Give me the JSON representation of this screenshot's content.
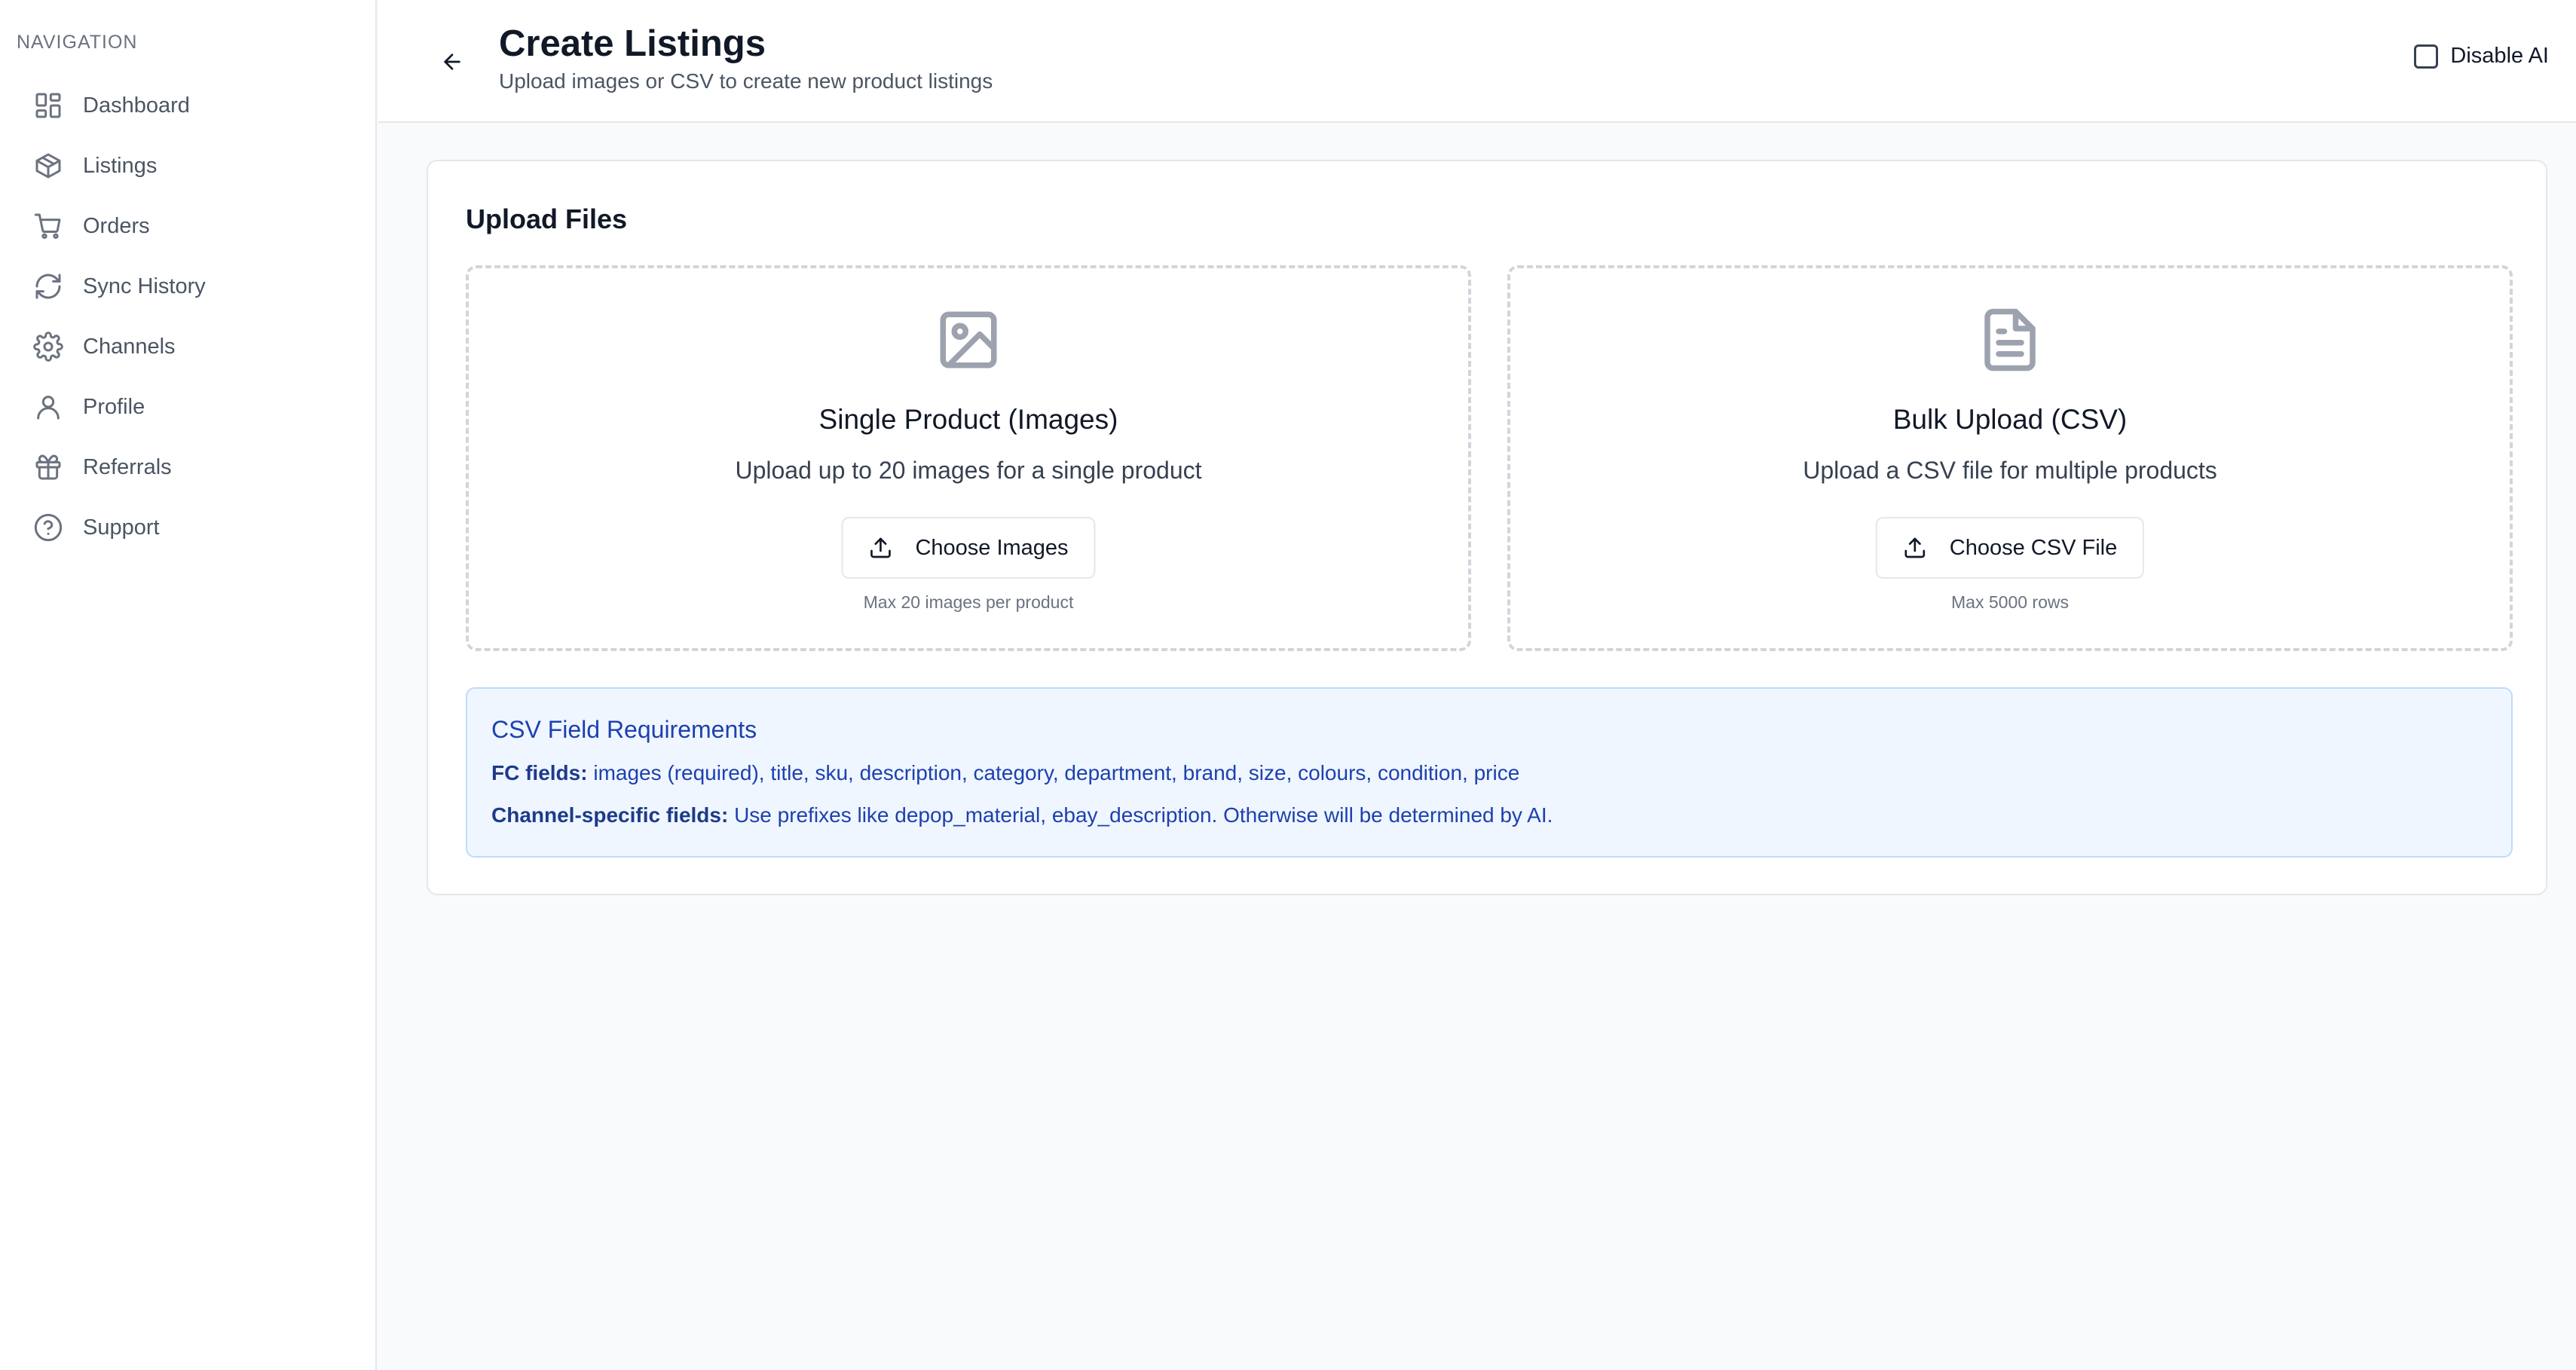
{
  "sidebar": {
    "heading": "NAVIGATION",
    "items": [
      {
        "label": "Dashboard",
        "icon": "dashboard-icon"
      },
      {
        "label": "Listings",
        "icon": "box-icon"
      },
      {
        "label": "Orders",
        "icon": "cart-icon"
      },
      {
        "label": "Sync History",
        "icon": "refresh-icon"
      },
      {
        "label": "Channels",
        "icon": "gear-icon"
      },
      {
        "label": "Profile",
        "icon": "user-icon"
      },
      {
        "label": "Referrals",
        "icon": "gift-icon"
      },
      {
        "label": "Support",
        "icon": "help-circle-icon"
      }
    ]
  },
  "header": {
    "title": "Create Listings",
    "subtitle": "Upload images or CSV to create new product listings",
    "disable_ai_label": "Disable AI",
    "disable_ai_checked": false
  },
  "upload": {
    "title": "Upload Files",
    "single": {
      "icon": "image-icon",
      "title": "Single Product (Images)",
      "description": "Upload up to 20 images for a single product",
      "button_label": "Choose Images",
      "note": "Max 20 images per product"
    },
    "bulk": {
      "icon": "file-text-icon",
      "title": "Bulk Upload (CSV)",
      "description": "Upload a CSV file for multiple products",
      "button_label": "Choose CSV File",
      "note": "Max 5000 rows"
    }
  },
  "requirements": {
    "title": "CSV Field Requirements",
    "fc_label": "FC fields:",
    "fc_text": " images (required), title, sku, description, category, department, brand, size, colours, condition, price",
    "channel_label": "Channel-specific fields:",
    "channel_text": " Use prefixes like depop_material, ebay_description. Otherwise will be determined by AI."
  },
  "colors": {
    "sidebar_text": "#4b5563",
    "info_bg": "#eff6ff",
    "info_text": "#1e40af",
    "dropzone_border": "#d1d5db",
    "icon_gray": "#9ca3af"
  }
}
